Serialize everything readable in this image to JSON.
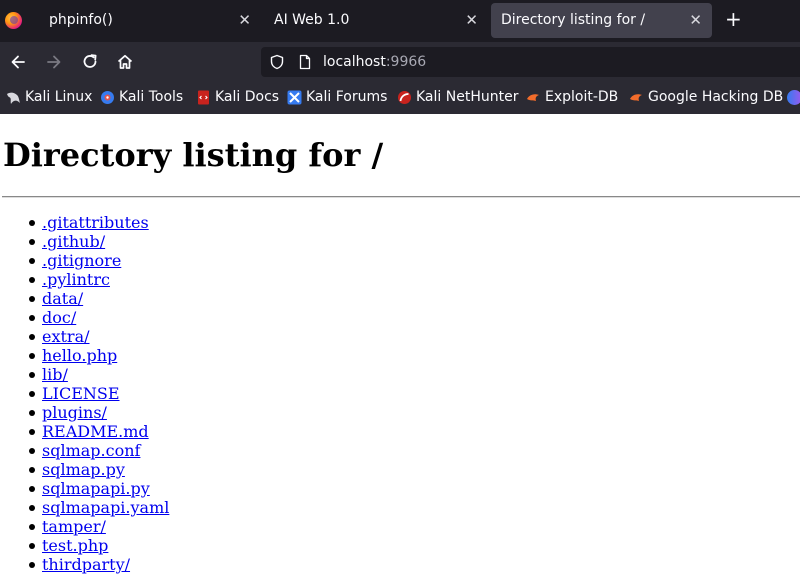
{
  "tabs": [
    {
      "title": "phpinfo()",
      "active": false
    },
    {
      "title": "AI Web 1.0",
      "active": false
    },
    {
      "title": "Directory listing for /",
      "active": true
    }
  ],
  "url": {
    "host": "localhost",
    "port": ":9966"
  },
  "bookmarks": [
    {
      "label": "Kali Linux",
      "icon": "kali-dragon-icon"
    },
    {
      "label": "Kali Tools",
      "icon": "kali-tools-icon"
    },
    {
      "label": "Kali Docs",
      "icon": "kali-docs-icon"
    },
    {
      "label": "Kali Forums",
      "icon": "kali-forums-icon"
    },
    {
      "label": "Kali NetHunter",
      "icon": "kali-nethunter-icon"
    },
    {
      "label": "Exploit-DB",
      "icon": "exploit-db-icon"
    },
    {
      "label": "Google Hacking DB",
      "icon": "google-hacking-db-icon"
    }
  ],
  "page": {
    "heading": "Directory listing for /",
    "entries": [
      ".gitattributes",
      ".github/",
      ".gitignore",
      ".pylintrc",
      "data/",
      "doc/",
      "extra/",
      "hello.php",
      "lib/",
      "LICENSE",
      "plugins/",
      "README.md",
      "sqlmap.conf",
      "sqlmap.py",
      "sqlmapapi.py",
      "sqlmapapi.yaml",
      "tamper/",
      "test.php",
      "thirdparty/"
    ]
  },
  "colors": {
    "link": "#0000ee",
    "tab_strip": "#1c1b22",
    "toolbar": "#2b2a33",
    "active_tab": "#42414d"
  }
}
